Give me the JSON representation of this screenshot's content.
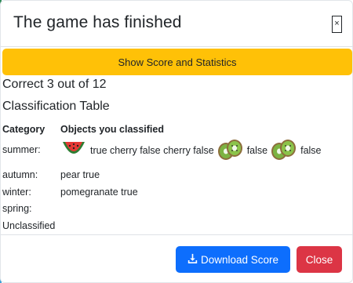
{
  "modal": {
    "title": "The game has finished",
    "close_glyph": "×",
    "score_button": "Show Score and Statistics",
    "result": "Correct 3 out of 12",
    "table_title": "Classification Table",
    "headers": {
      "category": "Category",
      "objects": "Objects you classified"
    }
  },
  "rows": {
    "summer": {
      "label": "summer:",
      "watermelon_icon": "watermelon-icon",
      "t1": "true cherry false cherry false",
      "kiwi_icon_1": "kiwi-icon",
      "t2": "false",
      "kiwi_icon_2": "kiwi-icon",
      "t3": "false"
    },
    "autumn": {
      "label": "autumn:",
      "text": "pear true"
    },
    "winter": {
      "label": "winter:",
      "text": "pomegranate true"
    },
    "spring": {
      "label": "spring:",
      "text": ""
    },
    "unclassified": {
      "label": "Unclassified",
      "text": ""
    }
  },
  "footer": {
    "download_label": "Download Score",
    "download_icon": "download-icon",
    "close_label": "Close"
  },
  "colors": {
    "score_button": "#ffc107",
    "download_button": "#0d6efd",
    "close_button": "#dc3545"
  }
}
